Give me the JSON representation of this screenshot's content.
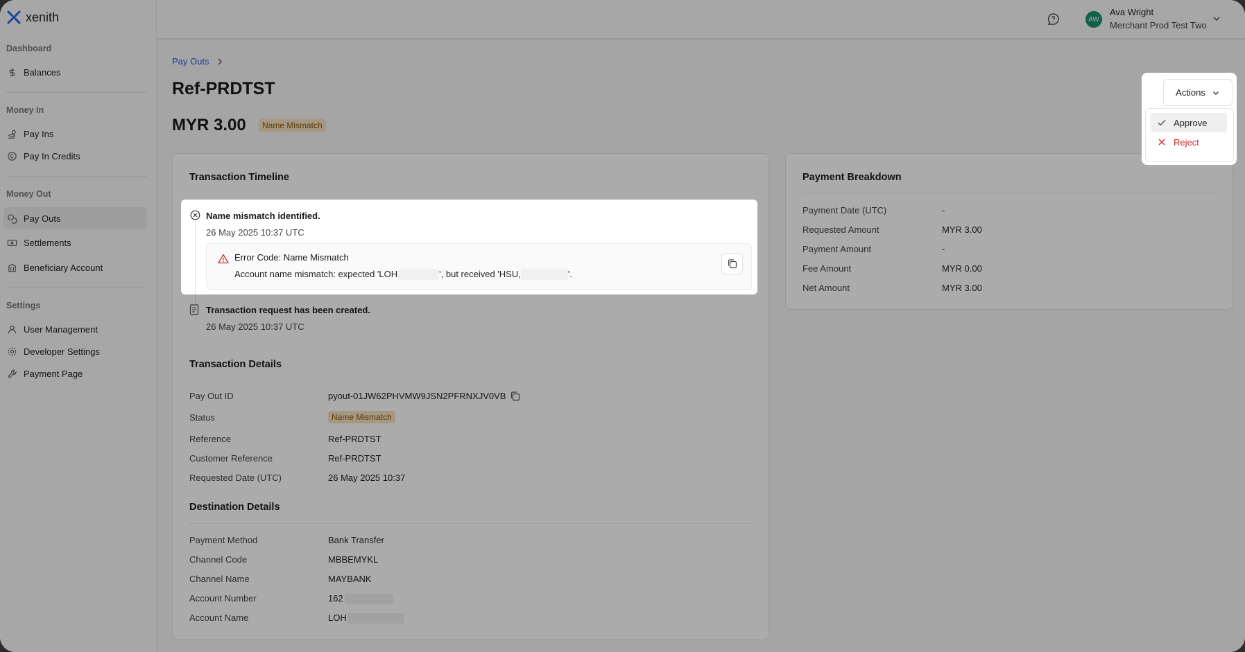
{
  "app": {
    "name": "xenith",
    "brand_color": "#2563eb"
  },
  "header": {
    "help_icon": "help-chat-icon",
    "user": {
      "initials": "AW",
      "name": "Ava Wright",
      "org": "Merchant Prod Test Two"
    }
  },
  "sidebar": {
    "sections": [
      {
        "title": "Dashboard",
        "items": [
          {
            "label": "Balances",
            "icon": "dollar-icon"
          }
        ]
      },
      {
        "title": "Money In",
        "items": [
          {
            "label": "Pay Ins",
            "icon": "hand-coins-icon"
          },
          {
            "label": "Pay In Credits",
            "icon": "copyright-icon"
          }
        ]
      },
      {
        "title": "Money Out",
        "items": [
          {
            "label": "Pay Outs",
            "icon": "coins-icon",
            "active": true
          },
          {
            "label": "Settlements",
            "icon": "banknote-icon"
          },
          {
            "label": "Beneficiary Account",
            "icon": "bank-icon"
          }
        ]
      },
      {
        "title": "Settings",
        "items": [
          {
            "label": "User Management",
            "icon": "user-icon"
          },
          {
            "label": "Developer Settings",
            "icon": "gear-icon"
          },
          {
            "label": "Payment Page",
            "icon": "wrench-icon"
          }
        ]
      }
    ]
  },
  "page": {
    "breadcrumb": "Pay Outs",
    "title": "Ref-PRDTST",
    "amount": "MYR 3.00",
    "status_badge": "Name Mismatch",
    "badge_bg": "#f6e2bf",
    "badge_fg": "#8a5a12"
  },
  "actions": {
    "button_label": "Actions",
    "items": {
      "approve": "Approve",
      "reject": "Reject"
    },
    "reject_color": "#d4282c"
  },
  "timeline": {
    "title": "Transaction Timeline",
    "events": [
      {
        "title": "Name mismatch identified.",
        "time": "26 May 2025 10:37 UTC",
        "error_code": "Error Code: Name Mismatch",
        "message_part1": "Account name mismatch: expected 'LOH",
        "message_part2": "', but received 'HSU,",
        "message_part3": "'."
      },
      {
        "title": "Transaction request has been created.",
        "time": "26 May 2025 10:37 UTC"
      }
    ]
  },
  "transaction_details": {
    "title": "Transaction Details",
    "rows": [
      {
        "label": "Pay Out ID",
        "value": "pyout-01JW62PHVMW9JSN2PFRNXJV0VB"
      },
      {
        "label": "Status",
        "value": "Name Mismatch"
      },
      {
        "label": "Reference",
        "value": "Ref-PRDTST"
      },
      {
        "label": "Customer Reference",
        "value": "Ref-PRDTST"
      },
      {
        "label": "Requested Date (UTC)",
        "value": "26 May 2025 10:37"
      }
    ]
  },
  "destination_details": {
    "title": "Destination Details",
    "rows": [
      {
        "label": "Payment Method",
        "value": "Bank Transfer"
      },
      {
        "label": "Channel Code",
        "value": "MBBEMYKL"
      },
      {
        "label": "Channel Name",
        "value": "MAYBANK"
      },
      {
        "label": "Account Number",
        "value": "162"
      },
      {
        "label": "Account Name",
        "value": "LOH"
      }
    ]
  },
  "payment_breakdown": {
    "title": "Payment Breakdown",
    "rows": [
      {
        "label": "Payment Date (UTC)",
        "value": "-"
      },
      {
        "label": "Requested Amount",
        "value": "MYR 3.00"
      },
      {
        "label": "Payment Amount",
        "value": "-"
      },
      {
        "label": "Fee Amount",
        "value": "MYR 0.00"
      },
      {
        "label": "Net Amount",
        "value": "MYR 3.00"
      }
    ]
  }
}
